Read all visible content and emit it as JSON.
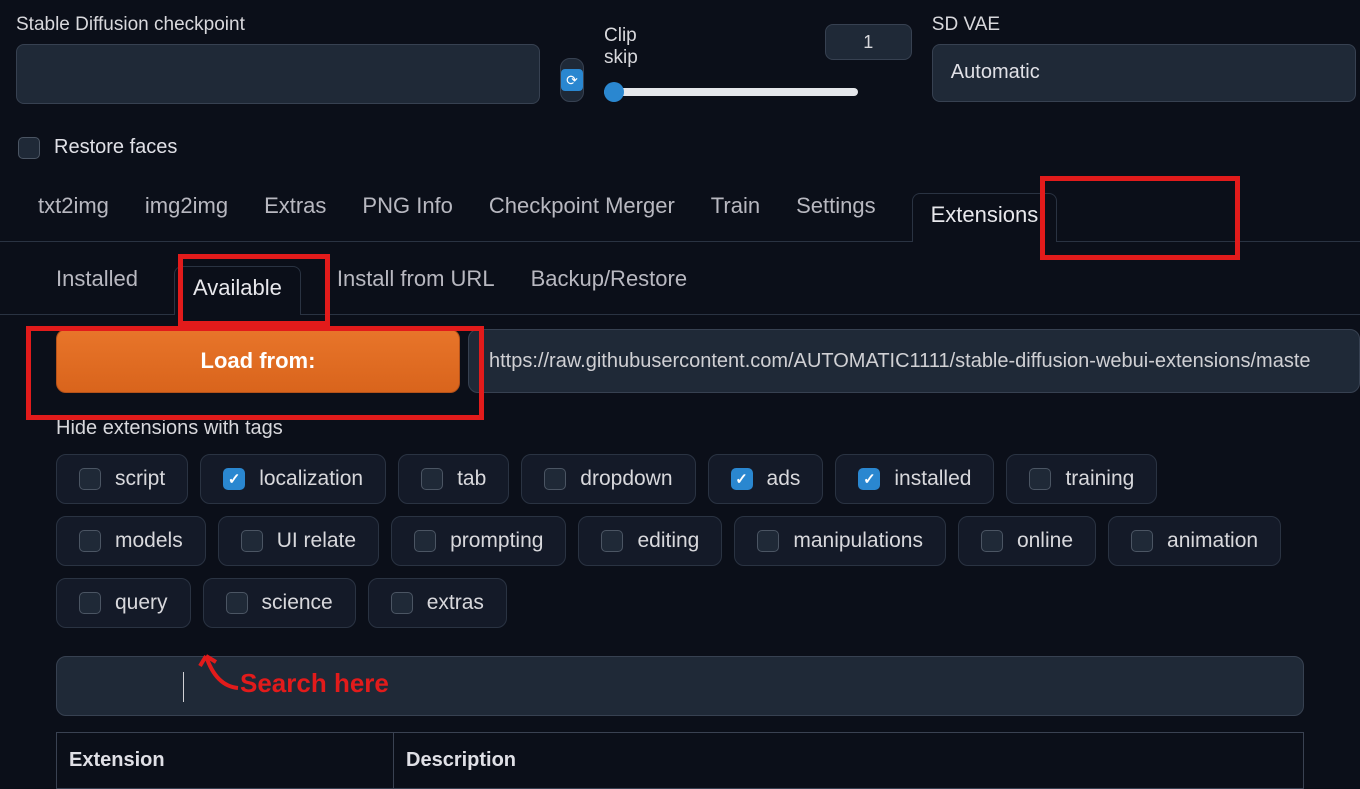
{
  "header": {
    "checkpoint_label": "Stable Diffusion checkpoint",
    "clip_label": "Clip skip",
    "clip_value": "1",
    "vae_label": "SD VAE",
    "vae_value": "Automatic"
  },
  "restore_faces_label": "Restore faces",
  "restore_faces_checked": false,
  "main_tabs": [
    {
      "label": "txt2img",
      "active": false
    },
    {
      "label": "img2img",
      "active": false
    },
    {
      "label": "Extras",
      "active": false
    },
    {
      "label": "PNG Info",
      "active": false
    },
    {
      "label": "Checkpoint Merger",
      "active": false
    },
    {
      "label": "Train",
      "active": false
    },
    {
      "label": "Settings",
      "active": false
    },
    {
      "label": "Extensions",
      "active": true
    }
  ],
  "sub_tabs": [
    {
      "label": "Installed",
      "active": false
    },
    {
      "label": "Available",
      "active": true
    },
    {
      "label": "Install from URL",
      "active": false
    },
    {
      "label": "Backup/Restore",
      "active": false
    }
  ],
  "load_button": "Load from:",
  "index_url": "https://raw.githubusercontent.com/AUTOMATIC1111/stable-diffusion-webui-extensions/maste",
  "hide_tags_label": "Hide extensions with tags",
  "tags": [
    {
      "label": "script",
      "checked": false
    },
    {
      "label": "localization",
      "checked": true
    },
    {
      "label": "tab",
      "checked": false
    },
    {
      "label": "dropdown",
      "checked": false
    },
    {
      "label": "ads",
      "checked": true
    },
    {
      "label": "installed",
      "checked": true
    },
    {
      "label": "training",
      "checked": false
    },
    {
      "label": "models",
      "checked": false
    },
    {
      "label": "UI relate",
      "checked": false
    },
    {
      "label": "prompting",
      "checked": false
    },
    {
      "label": "editing",
      "checked": false
    },
    {
      "label": "manipulations",
      "checked": false
    },
    {
      "label": "online",
      "checked": false
    },
    {
      "label": "animation",
      "checked": false
    },
    {
      "label": "query",
      "checked": false
    },
    {
      "label": "science",
      "checked": false
    },
    {
      "label": "extras",
      "checked": false
    }
  ],
  "table": {
    "col_extension": "Extension",
    "col_description": "Description"
  },
  "annotation_text": "Search here"
}
